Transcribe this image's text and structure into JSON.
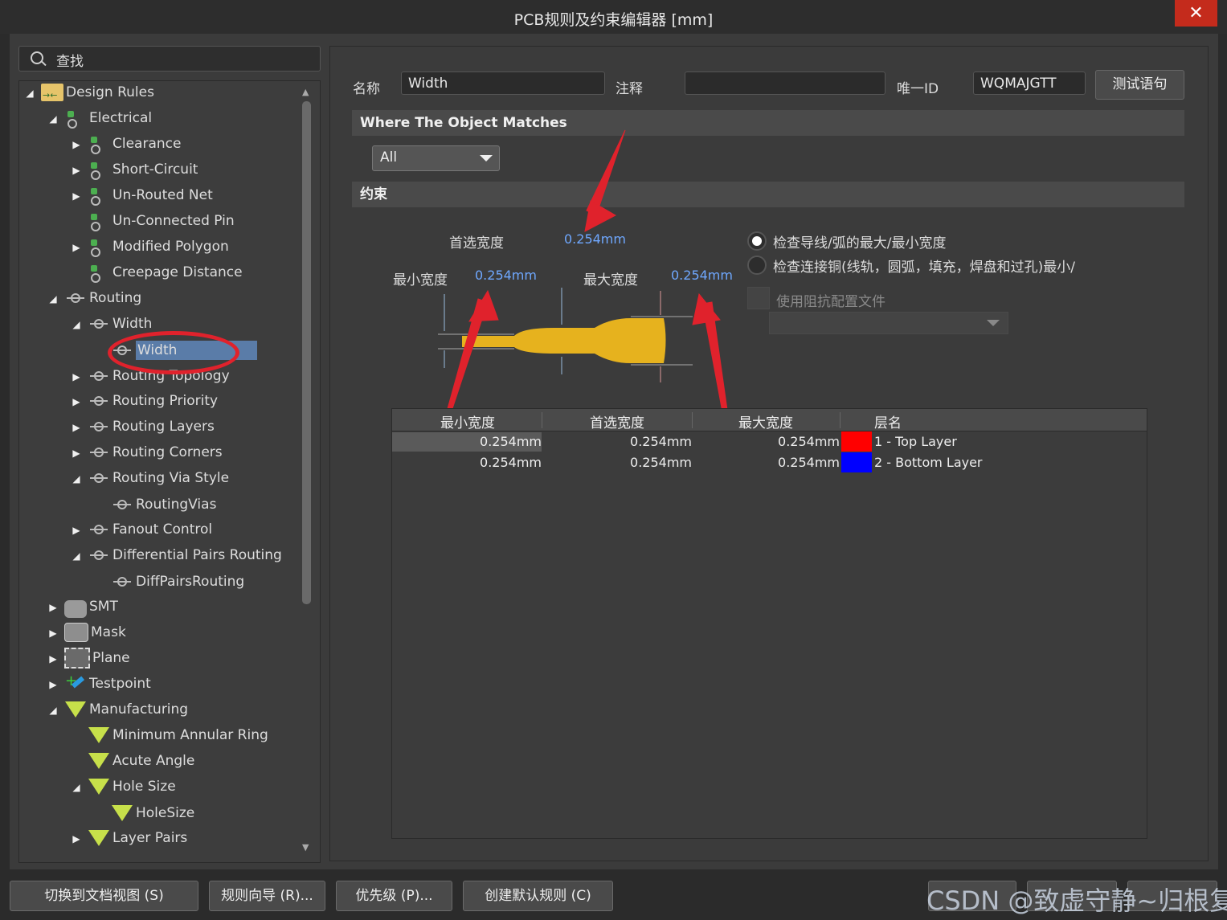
{
  "window": {
    "title": "PCB规则及约束编辑器 [mm]",
    "close_glyph": "✕"
  },
  "search": {
    "placeholder": "查找"
  },
  "tree": [
    {
      "label": "Design Rules",
      "expander": "◢"
    },
    {
      "label": "Electrical",
      "expander": "◢"
    },
    {
      "label": "Clearance",
      "expander": "▶"
    },
    {
      "label": "Short-Circuit",
      "expander": "▶"
    },
    {
      "label": "Un-Routed Net",
      "expander": "▶"
    },
    {
      "label": "Un-Connected Pin",
      "expander": ""
    },
    {
      "label": "Modified Polygon",
      "expander": "▶"
    },
    {
      "label": "Creepage Distance",
      "expander": ""
    },
    {
      "label": "Routing",
      "expander": "◢"
    },
    {
      "label": "Width",
      "expander": "◢"
    },
    {
      "label": "Width",
      "expander": ""
    },
    {
      "label": "Routing Topology",
      "expander": "▶"
    },
    {
      "label": "Routing Priority",
      "expander": "▶"
    },
    {
      "label": "Routing Layers",
      "expander": "▶"
    },
    {
      "label": "Routing Corners",
      "expander": "▶"
    },
    {
      "label": "Routing Via Style",
      "expander": "◢"
    },
    {
      "label": "RoutingVias",
      "expander": ""
    },
    {
      "label": "Fanout Control",
      "expander": "▶"
    },
    {
      "label": "Differential Pairs Routing",
      "expander": "◢"
    },
    {
      "label": "DiffPairsRouting",
      "expander": ""
    },
    {
      "label": "SMT",
      "expander": "▶"
    },
    {
      "label": "Mask",
      "expander": "▶"
    },
    {
      "label": "Plane",
      "expander": "▶"
    },
    {
      "label": "Testpoint",
      "expander": "▶"
    },
    {
      "label": "Manufacturing",
      "expander": "◢"
    },
    {
      "label": "Minimum Annular Ring",
      "expander": ""
    },
    {
      "label": "Acute Angle",
      "expander": ""
    },
    {
      "label": "Hole Size",
      "expander": "◢"
    },
    {
      "label": "HoleSize",
      "expander": ""
    },
    {
      "label": "Layer Pairs",
      "expander": "▶"
    }
  ],
  "rule": {
    "name_label": "名称",
    "name_value": "Width",
    "comment_label": "注释",
    "comment_value": "",
    "id_label": "唯一ID",
    "id_value": "WQMAJGTT",
    "test_button": "测试语句"
  },
  "where": {
    "header": "Where The Object Matches",
    "scope": "All"
  },
  "constraints": {
    "header": "约束",
    "preferred_label": "首选宽度",
    "preferred_value": "0.254mm",
    "min_label": "最小宽度",
    "min_value": "0.254mm",
    "max_label": "最大宽度",
    "max_value": "0.254mm",
    "option1": "检查导线/弧的最大/最小宽度",
    "option2": "检查连接铜(线轨，圆弧，填充，焊盘和过孔)最小/",
    "impedance_label": "使用阻抗配置文件",
    "selected_option": 1
  },
  "layer_table": {
    "headers": [
      "最小宽度",
      "首选宽度",
      "最大宽度",
      "层名"
    ],
    "rows": [
      {
        "min": "0.254mm",
        "pref": "0.254mm",
        "max": "0.254mm",
        "color": "#ff0000",
        "layer": "1 - Top Layer"
      },
      {
        "min": "0.254mm",
        "pref": "0.254mm",
        "max": "0.254mm",
        "color": "#0000ff",
        "layer": "2 - Bottom Layer"
      }
    ]
  },
  "bottom_buttons": {
    "doc_view": "切换到文档视图 (S)",
    "wizard": "规则向导 (R)...",
    "priority": "优先级 (P)...",
    "create_default": "创建默认规则 (C)"
  },
  "watermark": "CSDN @致虚守静~归根复命",
  "colors": {
    "accent_selection": "#5a7ca8",
    "annotation_red": "#e0222c",
    "trace_gold": "#e6b21e",
    "value_blue": "#6fa8ff"
  }
}
